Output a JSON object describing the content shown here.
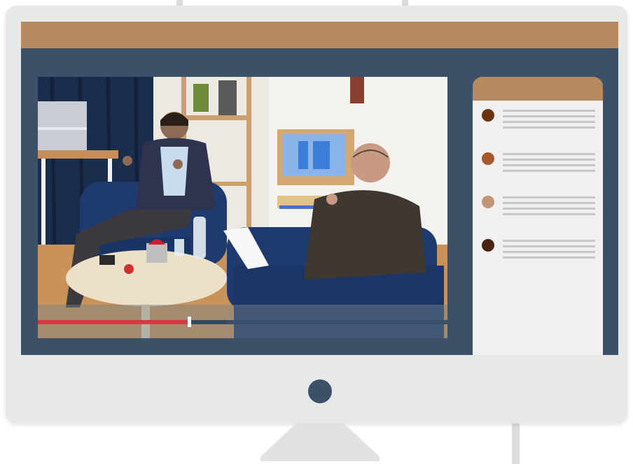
{
  "colors": {
    "frame": "#e7e8e8",
    "screen": "#3c5068",
    "accent_bar": "#b78a60",
    "progress_played": "#e03540",
    "progress_buffered": "#2f4a64",
    "sidebar_bg": "#f0f0f0",
    "power_button": "#3c5068"
  },
  "video": {
    "content": "two-men-seated-conversation-studio",
    "progress_fraction": 0.37,
    "buffered_fraction": 0.46
  },
  "sidebar": {
    "items": [
      {
        "dot_color": "#6a3410"
      },
      {
        "dot_color": "#a5582e"
      },
      {
        "dot_color": "#c09474"
      },
      {
        "dot_color": "#4a2410"
      }
    ]
  },
  "icons": {
    "power": "power-button-icon",
    "scrubber": "scrubber-thumb-icon"
  }
}
